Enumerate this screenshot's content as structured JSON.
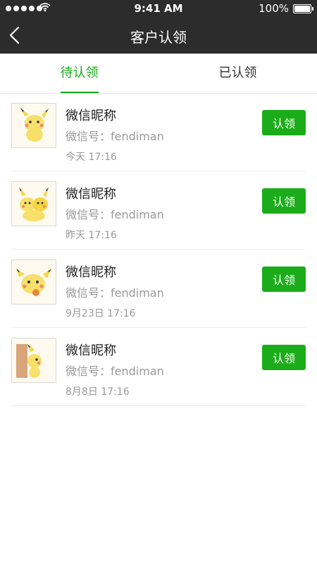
{
  "status_bar": {
    "time": "9:41 AM",
    "battery": "100%"
  },
  "header": {
    "title": "客户认领",
    "back_icon": "chevron-left-icon"
  },
  "tabs": [
    {
      "label": "待认领",
      "active": true
    },
    {
      "label": "已认领",
      "active": false
    }
  ],
  "accent_color": "#1aad19",
  "list": [
    {
      "name": "微信昵称",
      "wechat": "微信号：fendiman",
      "time": "今天 17:16",
      "button": "认领",
      "avatar_icon": "pikachu-avatar-icon"
    },
    {
      "name": "微信昵称",
      "wechat": "微信号：fendiman",
      "time": "昨天 17:16",
      "button": "认领",
      "avatar_icon": "pikachu-avatar-icon"
    },
    {
      "name": "微信昵称",
      "wechat": "微信号：fendiman",
      "time": "9月23日 17:16",
      "button": "认领",
      "avatar_icon": "pikachu-avatar-icon"
    },
    {
      "name": "微信昵称",
      "wechat": "微信号：fendiman",
      "time": "8月8日 17:16",
      "button": "认领",
      "avatar_icon": "pikachu-avatar-icon"
    }
  ]
}
